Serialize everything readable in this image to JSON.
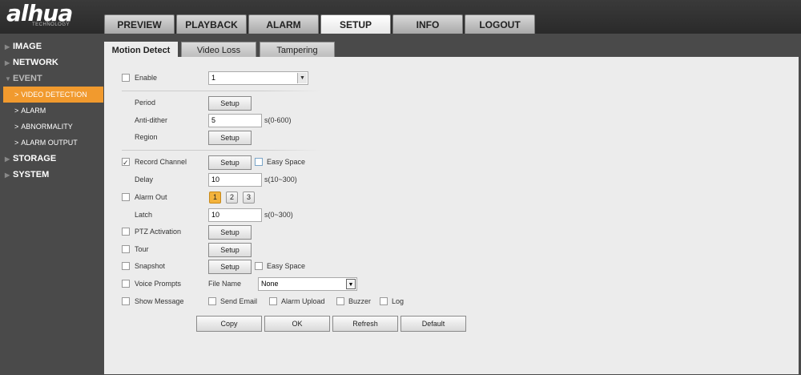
{
  "brand": {
    "name": "alhua",
    "tagline": "TECHNOLOGY"
  },
  "topnav": [
    "PREVIEW",
    "PLAYBACK",
    "ALARM",
    "SETUP",
    "INFO",
    "LOGOUT"
  ],
  "topnav_active": "SETUP",
  "sidebar": {
    "image": "IMAGE",
    "network": "NETWORK",
    "event": "EVENT",
    "event_items": [
      "VIDEO DETECTION",
      "ALARM",
      "ABNORMALITY",
      "ALARM OUTPUT"
    ],
    "storage": "STORAGE",
    "system": "SYSTEM"
  },
  "subtabs": [
    "Motion Detect",
    "Video Loss",
    "Tampering"
  ],
  "form": {
    "enable_label": "Enable",
    "enable_checked": false,
    "channel_value": "1",
    "period_label": "Period",
    "setup_label": "Setup",
    "antidither_label": "Anti-dither",
    "antidither_value": "5",
    "antidither_unit": "s(0-600)",
    "region_label": "Region",
    "record_channel_label": "Record Channel",
    "record_channel_checked": true,
    "easy_space_label": "Easy Space",
    "delay_label": "Delay",
    "delay_value": "10",
    "delay_unit": "s(10~300)",
    "alarm_out_label": "Alarm Out",
    "alarm_out_channels": [
      "1",
      "2",
      "3"
    ],
    "latch_label": "Latch",
    "latch_value": "10",
    "latch_unit": "s(0~300)",
    "ptz_label": "PTZ Activation",
    "tour_label": "Tour",
    "snapshot_label": "Snapshot",
    "voice_prompts_label": "Voice Prompts",
    "file_name_label": "File Name",
    "file_name_value": "None",
    "show_message_label": "Show Message",
    "send_email_label": "Send Email",
    "alarm_upload_label": "Alarm Upload",
    "buzzer_label": "Buzzer",
    "log_label": "Log"
  },
  "actions": {
    "copy": "Copy",
    "ok": "OK",
    "refresh": "Refresh",
    "default": "Default"
  },
  "colors": {
    "accent": "#f19a2e",
    "background": "#4a4a4a",
    "panel": "#ececec"
  }
}
